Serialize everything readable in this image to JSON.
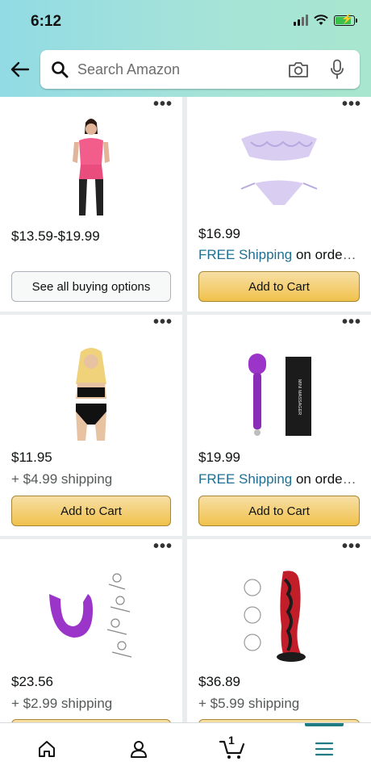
{
  "status": {
    "time": "6:12"
  },
  "search": {
    "placeholder": "Search Amazon"
  },
  "products": [
    {
      "price": "$13.59-$19.99",
      "button": "See all buying options"
    },
    {
      "price": "$16.99",
      "ship_free": "FREE Shipping",
      "ship_rest": " on order…",
      "button": "Add to Cart"
    },
    {
      "price": "$11.95",
      "shipping": "+ $4.99 shipping",
      "button": "Add to Cart"
    },
    {
      "price": "$19.99",
      "ship_free": "FREE Shipping",
      "ship_rest": " on order…",
      "box_text": "MINI MASSAGER",
      "button": "Add to Cart"
    },
    {
      "price": "$23.56",
      "shipping": "+ $2.99 shipping"
    },
    {
      "price": "$36.89",
      "shipping": "+ $5.99 shipping"
    }
  ],
  "nav": {
    "cart_count": "1",
    "active_tab": "menu"
  },
  "colors": {
    "accent_teal": "#1f7c85",
    "button_yellow": "#f0c14b",
    "link_blue": "#1e6f93"
  }
}
